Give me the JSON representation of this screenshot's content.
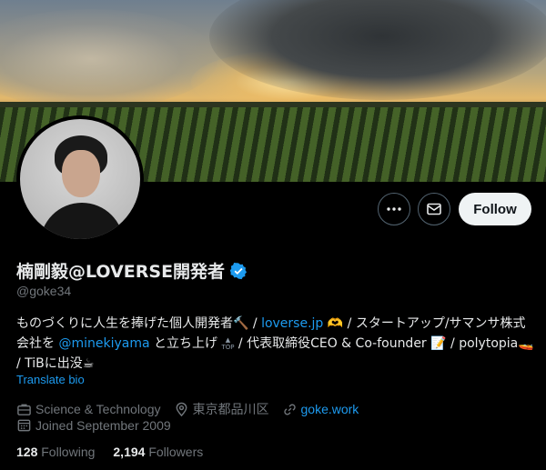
{
  "profile": {
    "display_name": "楠剛毅@LOVERSE開発者",
    "handle": "@goke34",
    "verified": true,
    "bio": {
      "part1": "ものづくりに人生を捧げた個人開発者",
      "emoji1": "🔨",
      "sep1": " / ",
      "link1": "loverse.jp",
      "emoji2": "🫶",
      "part2": " / スタートアップ/サマンサ株式会社を ",
      "mention": "@minekiyama",
      "part3": " と立ち上げ",
      "top_badge": "TOP",
      "part4": " / 代表取締役CEO & Co-founder ",
      "emoji3": "📝",
      "part5": " / polytopia",
      "emoji4": "🚤",
      "part6": " / TiBに出没",
      "emoji5": "☕"
    },
    "translate_label": "Translate bio",
    "category": "Science & Technology",
    "location": "東京都品川区",
    "website": "goke.work",
    "joined": "Joined September 2009",
    "following_count": "128",
    "following_label": "Following",
    "followers_count": "2,194",
    "followers_label": "Followers"
  },
  "actions": {
    "more_icon": "more-icon",
    "message_icon": "envelope-icon",
    "follow_label": "Follow"
  },
  "colors": {
    "accent": "#1d9bf0",
    "secondary_text": "#71767b",
    "background": "#000000",
    "follow_button_bg": "#eff3f4"
  }
}
